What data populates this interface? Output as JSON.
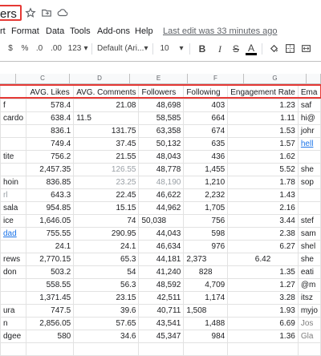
{
  "title_bar": {
    "doc_title": "ers",
    "icons": [
      "star-icon",
      "move-to-folder-icon",
      "cloud-status-icon"
    ]
  },
  "menu": {
    "items": [
      "rt",
      "Format",
      "Data",
      "Tools",
      "Add-ons",
      "Help"
    ],
    "last_edit": "Last edit was 33 minutes ago"
  },
  "toolbar": {
    "currency": "$",
    "percent": "%",
    "dec_decrease": ".0",
    "dec_increase": ".00",
    "more_formats": "123",
    "font": "Default (Ari...",
    "font_size": "10",
    "bold": "B",
    "italic": "I",
    "strikethrough": "S",
    "text_color": "A"
  },
  "columns": {
    "letters": [
      "C",
      "D",
      "E",
      "F",
      "G"
    ]
  },
  "table": {
    "headers": [
      "",
      "AVG. Likes",
      "AVG. Comments",
      "Followers",
      "Following",
      "Engagement Rate",
      "Ema"
    ],
    "rows": [
      [
        "f",
        "578.4",
        "21.08",
        "48,698",
        "403",
        "1.23",
        "saf"
      ],
      [
        "cardo",
        "638.4",
        "11.5",
        "58,585",
        "664",
        "1.11",
        "hi@"
      ],
      [
        "",
        "836.1",
        "131.75",
        "63,358",
        "674",
        "1.53",
        "johr"
      ],
      [
        "",
        "749.4",
        "37.45",
        "50,132",
        "635",
        "1.57",
        "hell"
      ],
      [
        "tite",
        "756.2",
        "21.55",
        "48,043",
        "436",
        "1.62",
        ""
      ],
      [
        "",
        "2,457.35",
        "126.55",
        "48,778",
        "1,455",
        "5.52",
        "she"
      ],
      [
        "hoin",
        "836.85",
        "23.25",
        "48,190",
        "1,210",
        "1.78",
        "sop"
      ],
      [
        "rl",
        "643.3",
        "22.45",
        "46,622",
        "2,232",
        "1.43",
        ""
      ],
      [
        "sala",
        "954.85",
        "15.15",
        "44,962",
        "1,705",
        "2.16",
        ""
      ],
      [
        "ice",
        "1,646.05",
        "74",
        "50,038",
        "756",
        "3.44",
        "stef"
      ],
      [
        "dad",
        "755.55",
        "290.95",
        "44,043",
        "598",
        "2.38",
        "sam"
      ],
      [
        "",
        "24.1",
        "24.1",
        "46,634",
        "976",
        "6.27",
        "shel"
      ],
      [
        "rews",
        "2,770.15",
        "65.3",
        "44,181",
        "2,373",
        "6.42",
        "she"
      ],
      [
        "don",
        "503.2",
        "54",
        "41,240",
        "828",
        "1.35",
        "eati"
      ],
      [
        "",
        "558.55",
        "56.3",
        "48,592",
        "4,709",
        "1.27",
        "@m"
      ],
      [
        "",
        "1,371.45",
        "23.15",
        "42,511",
        "1,174",
        "3.28",
        "itsz"
      ],
      [
        "ura",
        "747.5",
        "39.6",
        "40,711",
        "1,508",
        "1.93",
        "myjo"
      ],
      [
        "n",
        "2,856.05",
        "57.65",
        "43,541",
        "1,488",
        "6.69",
        "Jos"
      ],
      [
        "dgee",
        "580",
        "34.6",
        "45,347",
        "984",
        "1.36",
        "Gla"
      ],
      [
        "",
        "",
        "",
        "",
        "",
        "",
        ""
      ]
    ]
  }
}
